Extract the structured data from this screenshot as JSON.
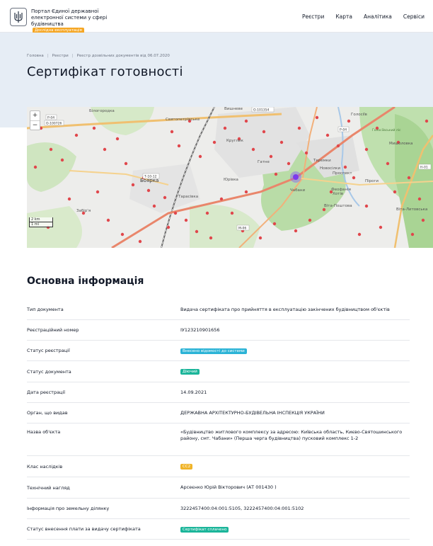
{
  "header": {
    "brand_lines": [
      "Портал Єдиної державної",
      "електронної системи у сфері",
      "будівництва"
    ],
    "beta_label": "Дослідна експлуатація",
    "nav": [
      "Реєстри",
      "Карта",
      "Аналітика",
      "Сервіси"
    ]
  },
  "breadcrumb": [
    "Головна",
    "Реєстри",
    "Реєстр дозвільних документів від 06.07.2020"
  ],
  "page_title": "Сертифікат готовності",
  "map": {
    "zoom_in": "+",
    "zoom_out": "−",
    "scale": [
      "2 km",
      "1 mi"
    ],
    "labels": [
      "Вишневе",
      "Голосіїв",
      "Теремки",
      "Новосілки",
      "Проспект",
      "Піроги",
      "Хотів",
      "Віта-Поштова",
      "Боярка",
      "Тарасівка",
      "Юрівка",
      "Білогородка",
      "Забір'я",
      "Круглик",
      "Гатне",
      "Святопетрівське",
      "Мишоловка",
      "Феофанія",
      "Чабани",
      "Голосіївський ліс",
      "Віта-Литовська"
    ],
    "road_labels": [
      "Р-04",
      "О-100726",
      "Т-10-12",
      "Р-04",
      "H-01",
      "М-06",
      "О-101354"
    ]
  },
  "section_title": "Основна інформація",
  "fields": [
    {
      "label": "Тип документа",
      "value": "Видача сертифіката про прийняття в експлуатацію закінчених будівництвом об'єктів"
    },
    {
      "label": "Реєстраційний номер",
      "value": "IУ123210901656"
    },
    {
      "label": "Статус реєстрації",
      "badge": "Внесено відомості до системи",
      "badge_color": "#2bb3d6"
    },
    {
      "label": "Статус документа",
      "badge": "Діючий",
      "badge_color": "#1bb59a"
    },
    {
      "label": "Дата реєстрації",
      "value": "14.09.2021"
    },
    {
      "label": "Орган, що видав",
      "value": "ДЕРЖАВНА АРХІТЕКТУРНО-БУДІВЕЛЬНА ІНСПЕКЦІЯ УКРАЇНИ"
    },
    {
      "label": "Назва об'єкта",
      "value": "«Будівництво житлового комплексу за адресою: Київська область, Києво-Святошинського району, смт. Чабани» (Перша черга будівництва) пусковий комплекс 1-2"
    },
    {
      "label": "Клас наслідків",
      "badge": "СС2",
      "badge_color": "#f0b429"
    },
    {
      "label": "Технічний нагляд",
      "value": "Арсеєнко Юрій Вікторович (АТ 001430 )"
    },
    {
      "label": "Інформація про земельну ділянку",
      "value": "3222457400:04:001:5105, 3222457400:04:001:5102"
    },
    {
      "label": "Статус внесення плати за видачу сертифіката",
      "badge": "Сертифікат сплачено",
      "badge_color": "#1bb59a"
    }
  ]
}
